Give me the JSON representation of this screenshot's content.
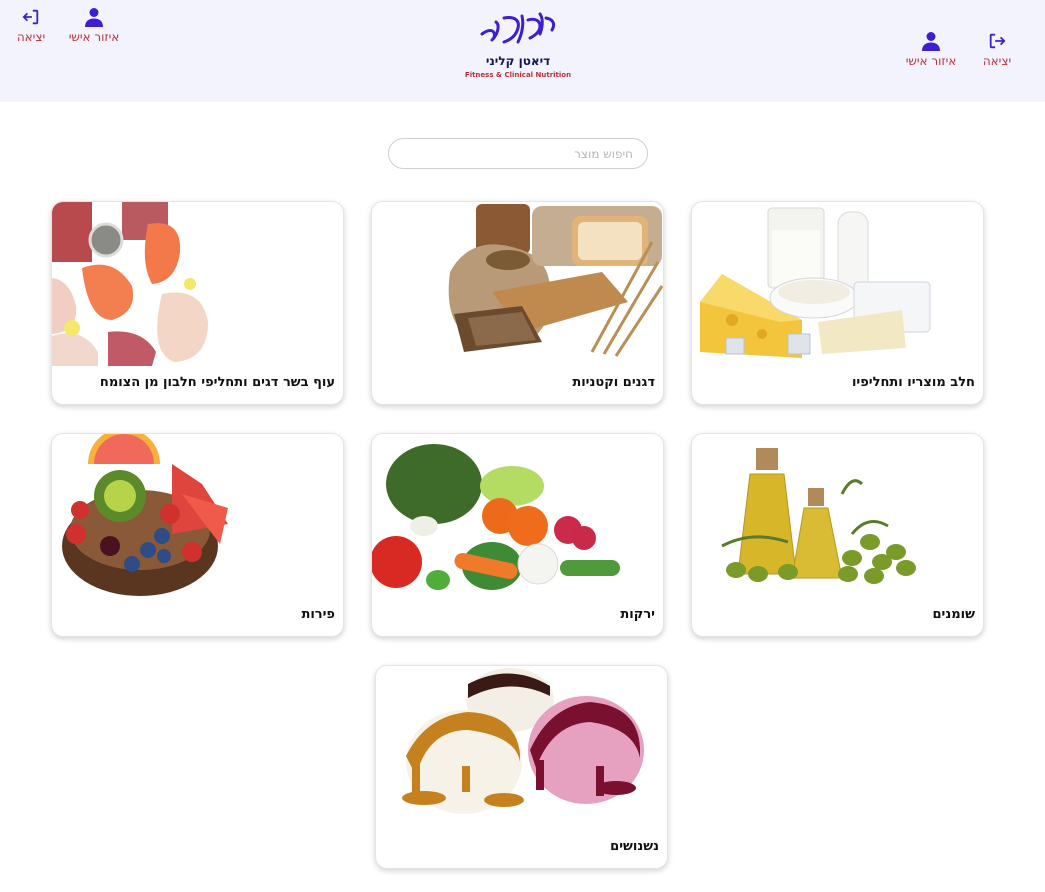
{
  "header": {
    "logout_label": "יציאה",
    "personal_area_label": "איזור אישי",
    "logo_script": "ניאלי",
    "logo_subtitle": "דיאטן קליני",
    "logo_tagline": "Fitness & Clinical Nutrition"
  },
  "search": {
    "placeholder": "חיפוש מוצר"
  },
  "categories": [
    {
      "label": "חלב מוצריו ותחליפיו",
      "icon": "dairy-image"
    },
    {
      "label": "דגנים וקטניות",
      "icon": "grains-image"
    },
    {
      "label": "עוף בשר דגים ותחליפי חלבון מן הצומח",
      "icon": "protein-image"
    },
    {
      "label": "שומנים",
      "icon": "oils-image"
    },
    {
      "label": "ירקות",
      "icon": "vegetables-image"
    },
    {
      "label": "פירות",
      "icon": "fruits-image"
    },
    {
      "label": "נשנושים",
      "icon": "snacks-image"
    }
  ],
  "colors": {
    "accent": "#3d1fd1",
    "header_bg": "#f3f3fd",
    "label_red": "#c0303a"
  }
}
